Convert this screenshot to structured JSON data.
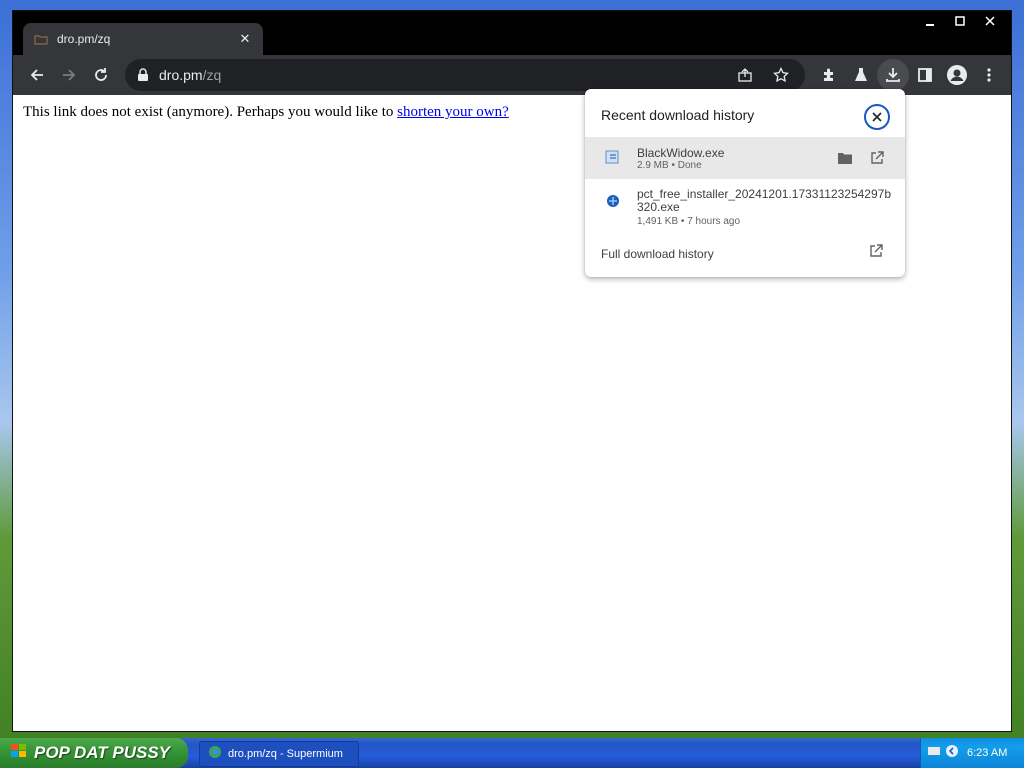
{
  "browser": {
    "tab_title": "dro.pm/zq",
    "url_host": "dro.pm",
    "url_path": "/zq"
  },
  "page": {
    "message": "This link does not exist (anymore). Perhaps you would like to",
    "link_text": "shorten your own?"
  },
  "downloads": {
    "header": "Recent download history",
    "items": [
      {
        "name": "BlackWidow.exe",
        "meta": "2.9 MB • Done"
      },
      {
        "name": "pct_free_installer_20241201.17331123254297b320.exe",
        "meta": "1,491 KB • 7 hours ago"
      }
    ],
    "full_history_label": "Full download history"
  },
  "taskbar": {
    "start_label": "POP DAT PUSSY",
    "task_label": "dro.pm/zq - Supermium",
    "clock": "6:23 AM"
  }
}
